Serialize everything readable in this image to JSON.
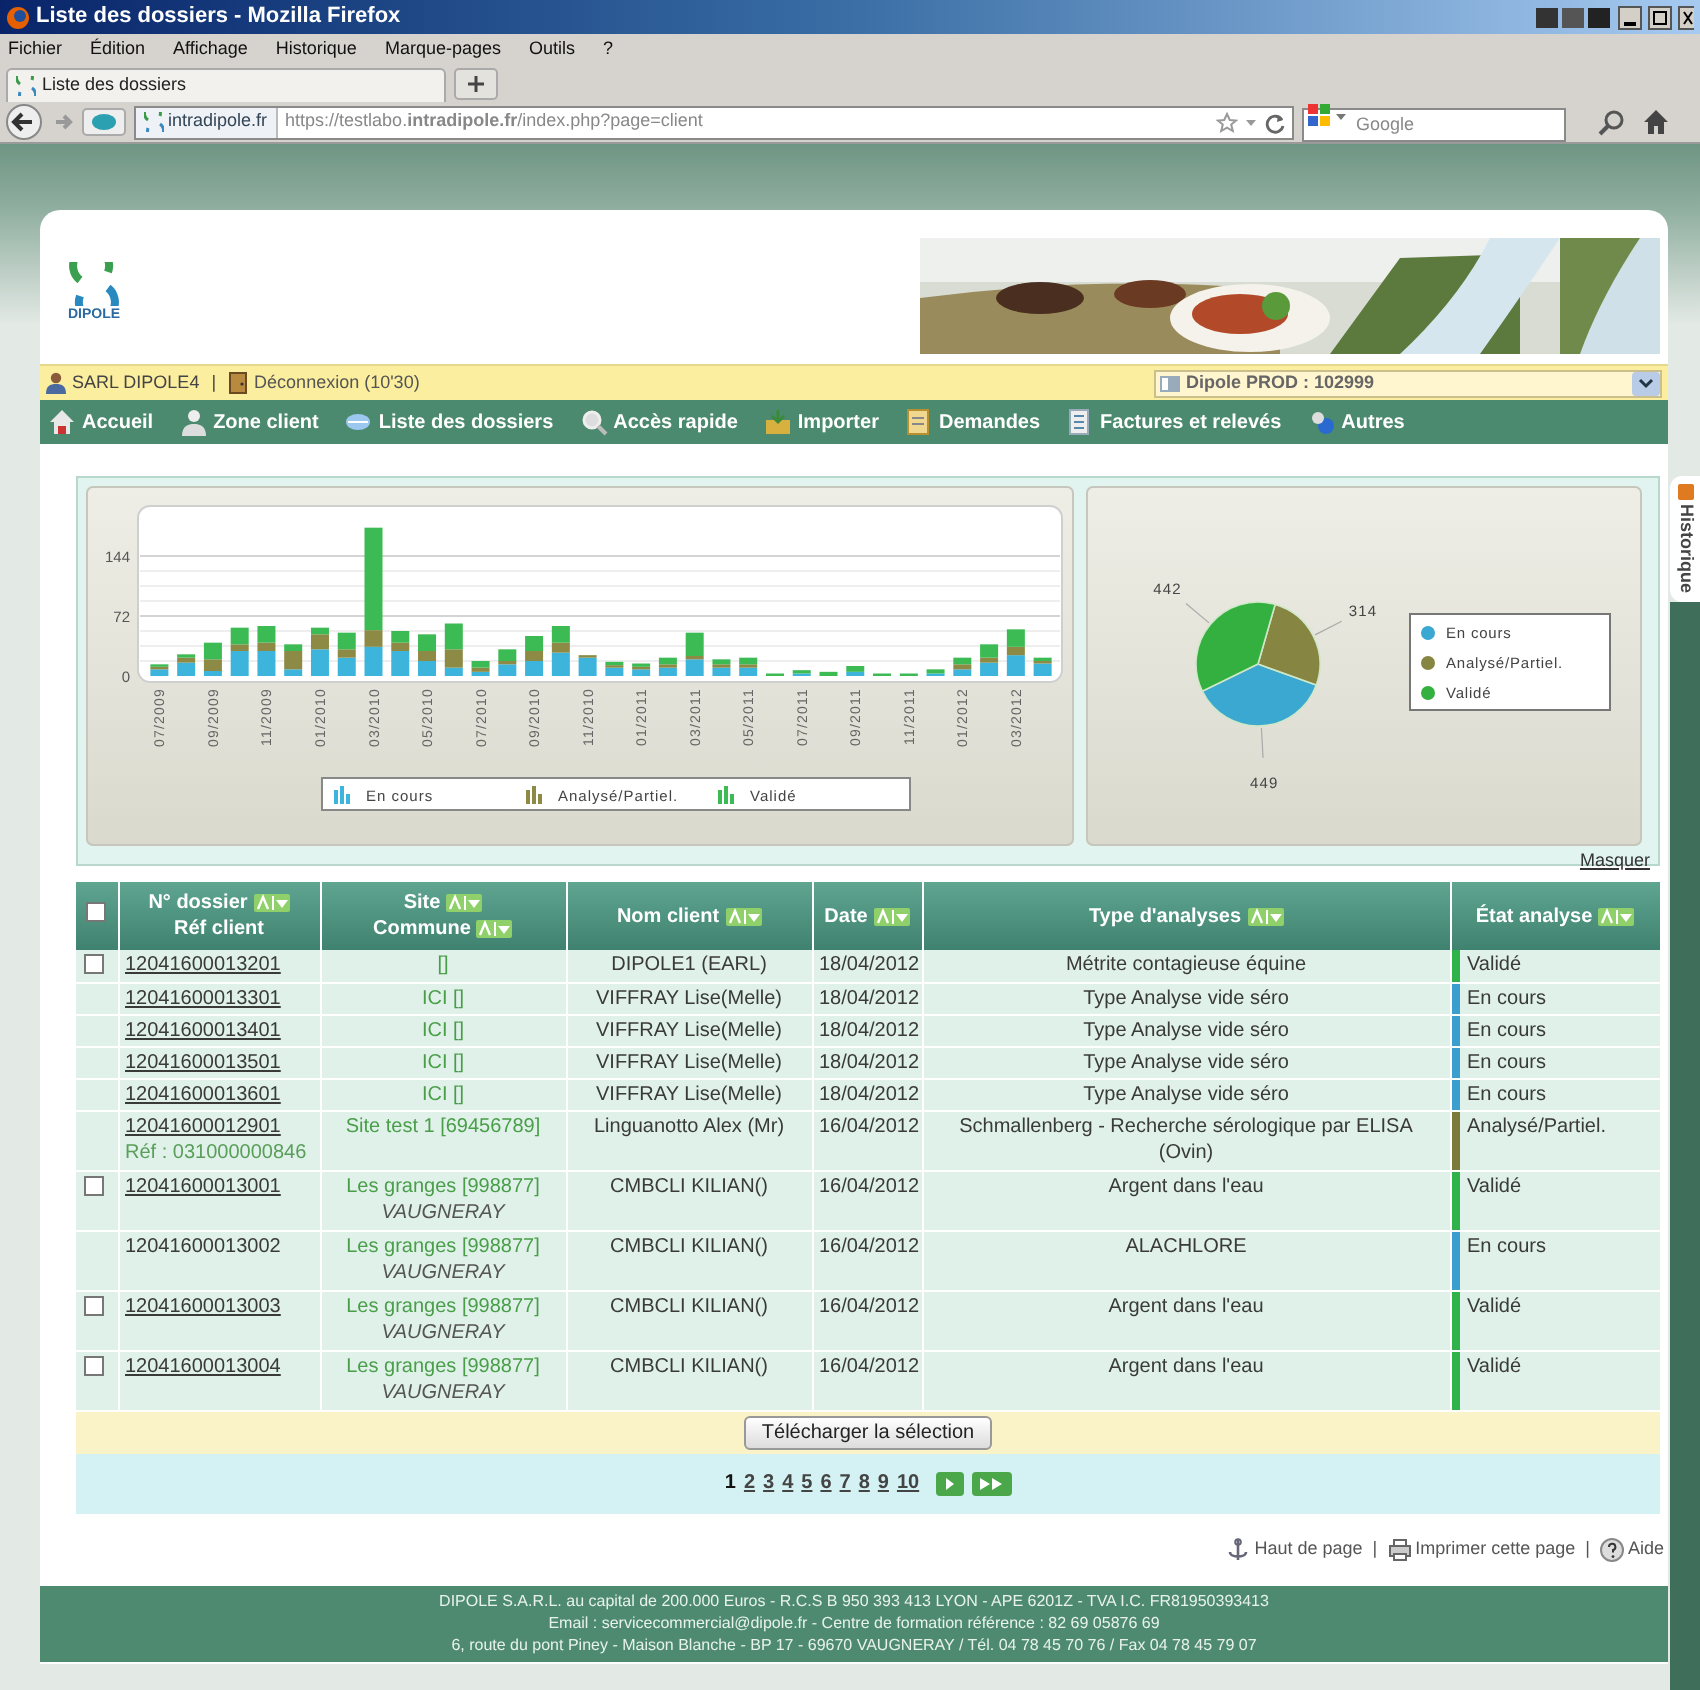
{
  "browser": {
    "title": "Liste des dossiers - Mozilla Firefox",
    "menu": [
      "Fichier",
      "Édition",
      "Affichage",
      "Historique",
      "Marque-pages",
      "Outils",
      "?"
    ],
    "tab": "Liste des dossiers",
    "identity": "intradipole.fr",
    "url": "https://testlabo.**intradipole.fr**/index.php?page=client",
    "search_placeholder": "Google"
  },
  "header": {
    "logo": "DIPOLE"
  },
  "user_bar": {
    "user": "SARL DIPOLE4",
    "separator": "|",
    "logout": "Déconnexion (10'30)",
    "account": "Dipole PROD : 102999"
  },
  "nav": [
    "Accueil",
    "Zone client",
    "Liste des dossiers",
    "Accès rapide",
    "Importer",
    "Demandes",
    "Factures et relevés",
    "Autres"
  ],
  "side_tab": "Historique",
  "bar_chart": {
    "chart_data": {
      "type": "bar",
      "stacked": true,
      "legend": "bottom",
      "categories": [
        "07/2009",
        null,
        "09/2009",
        null,
        "11/2009",
        null,
        "01/2010",
        null,
        "03/2010",
        null,
        "05/2010",
        null,
        "07/2010",
        null,
        "09/2010",
        null,
        "11/2010",
        null,
        "01/2011",
        null,
        "03/2011",
        null,
        "05/2011",
        null,
        "07/2011",
        null,
        "09/2011",
        null,
        "11/2011",
        null,
        "01/2012",
        null,
        "03/2012",
        null
      ],
      "ylim": [
        0,
        204
      ],
      "yticks": [
        0,
        72,
        144
      ],
      "series": [
        {
          "name": "En cours",
          "color": "#3db4dc",
          "values": [
            8,
            16,
            6,
            30,
            30,
            8,
            32,
            22,
            35,
            30,
            18,
            10,
            5,
            14,
            18,
            28,
            22,
            10,
            8,
            10,
            20,
            10,
            10,
            0,
            3,
            0,
            5,
            0,
            0,
            3,
            8,
            16,
            25,
            15
          ]
        },
        {
          "name": "Analysé/Partiel.",
          "color": "#8c8a44",
          "values": [
            3,
            6,
            14,
            8,
            10,
            22,
            18,
            10,
            20,
            10,
            12,
            22,
            5,
            4,
            12,
            12,
            3,
            3,
            3,
            4,
            4,
            4,
            4,
            0,
            0,
            0,
            0,
            0,
            0,
            0,
            6,
            6,
            10,
            3
          ]
        },
        {
          "name": "Validé",
          "color": "#3cba54",
          "values": [
            3,
            4,
            20,
            20,
            20,
            8,
            8,
            20,
            123,
            14,
            20,
            31,
            8,
            14,
            18,
            20,
            0,
            4,
            4,
            8,
            28,
            6,
            8,
            3,
            4,
            5,
            7,
            3,
            3,
            5,
            8,
            16,
            21,
            4
          ]
        }
      ]
    }
  },
  "pie_chart": {
    "chart_data": {
      "type": "pie",
      "data_labels": true,
      "legend": "right",
      "categories": [
        "En cours",
        "Analysé/Partiel.",
        "Validé"
      ],
      "values": [
        449,
        314,
        442
      ]
    }
  },
  "hide_link": "Masquer",
  "table": {
    "header_checkbox": {
      "checked": false
    },
    "columns": [
      {
        "lines": [
          {
            "text": "N° dossier",
            "sort": true
          },
          {
            "text": "Réf client",
            "sort": false
          }
        ]
      },
      {
        "lines": [
          {
            "text": "Site",
            "sort": true
          },
          {
            "text": "Commune",
            "sort": true
          }
        ]
      },
      {
        "lines": [
          {
            "text": "Nom client",
            "sort": true
          }
        ]
      },
      {
        "lines": [
          {
            "text": "Date",
            "sort": true
          }
        ]
      },
      {
        "lines": [
          {
            "text": "Type d'analyses",
            "sort": true
          }
        ]
      },
      {
        "lines": [
          {
            "text": "État analyse",
            "sort": true
          }
        ]
      }
    ],
    "rows": [
      {
        "checkbox": {
          "checked": false
        },
        "dossier": "12041600013201",
        "linked": true,
        "site": "[]",
        "client": "DIPOLE1 (EARL)",
        "date": "18/04/2012",
        "analyse": "Métrite contagieuse équine",
        "etat": "Validé",
        "color": "#2fb24a"
      },
      {
        "dossier": "12041600013301",
        "linked": true,
        "site": "ICI []",
        "client": "VIFFRAY Lise(Melle)",
        "date": "18/04/2012",
        "analyse": "Type Analyse vide séro",
        "etat": "En cours",
        "color": "#3a9fcf"
      },
      {
        "dossier": "12041600013401",
        "linked": true,
        "site": "ICI []",
        "client": "VIFFRAY Lise(Melle)",
        "date": "18/04/2012",
        "analyse": "Type Analyse vide séro",
        "etat": "En cours",
        "color": "#3a9fcf"
      },
      {
        "dossier": "12041600013501",
        "linked": true,
        "site": "ICI []",
        "client": "VIFFRAY Lise(Melle)",
        "date": "18/04/2012",
        "analyse": "Type Analyse vide séro",
        "etat": "En cours",
        "color": "#3a9fcf"
      },
      {
        "dossier": "12041600013601",
        "linked": true,
        "site": "ICI []",
        "client": "VIFFRAY Lise(Melle)",
        "date": "18/04/2012",
        "analyse": "Type Analyse vide séro",
        "etat": "En cours",
        "color": "#3a9fcf"
      },
      {
        "dossier": "12041600012901",
        "linked": true,
        "ref": "Réf : 031000000846",
        "site": "Site test 1 [69456789]",
        "client": "Linguanotto Alex (Mr)",
        "date": "16/04/2012",
        "analyse": "Schmallenberg - Recherche sérologique par ELISA (Ovin)",
        "etat": "Analysé/Partiel.",
        "color": "#7c7a3a"
      },
      {
        "checkbox": {
          "checked": false
        },
        "dossier": "12041600013001",
        "linked": true,
        "site": "Les granges [998877]",
        "commune": "VAUGNERAY",
        "client": "CMBCLI KILIAN()",
        "date": "16/04/2012",
        "analyse": "Argent dans l'eau",
        "etat": "Validé",
        "color": "#2fb24a"
      },
      {
        "dossier": "12041600013002",
        "linked": false,
        "site": "Les granges [998877]",
        "commune": "VAUGNERAY",
        "client": "CMBCLI KILIAN()",
        "date": "16/04/2012",
        "analyse": "ALACHLORE",
        "etat": "En cours",
        "color": "#3a9fcf"
      },
      {
        "checkbox": {
          "checked": false
        },
        "dossier": "12041600013003",
        "linked": true,
        "site": "Les granges [998877]",
        "commune": "VAUGNERAY",
        "client": "CMBCLI KILIAN()",
        "date": "16/04/2012",
        "analyse": "Argent dans l'eau",
        "etat": "Validé",
        "color": "#2fb24a"
      },
      {
        "checkbox": {
          "checked": false
        },
        "dossier": "12041600013004",
        "linked": true,
        "site": "Les granges [998877]",
        "commune": "VAUGNERAY",
        "client": "CMBCLI KILIAN()",
        "date": "16/04/2012",
        "analyse": "Argent dans l'eau",
        "etat": "Validé",
        "color": "#2fb24a"
      }
    ]
  },
  "download_button": "Télécharger la sélection",
  "pagination": {
    "pages": [
      {
        "label": "1",
        "selected": true
      },
      {
        "label": "2",
        "selected": false
      },
      {
        "label": "3",
        "selected": false
      },
      {
        "label": "4",
        "selected": false
      },
      {
        "label": "5",
        "selected": false
      },
      {
        "label": "6",
        "selected": false
      },
      {
        "label": "7",
        "selected": false
      },
      {
        "label": "8",
        "selected": false
      },
      {
        "label": "9",
        "selected": false
      },
      {
        "label": "10",
        "selected": false
      }
    ]
  },
  "page_links": {
    "separator": "|",
    "items": [
      "Haut de page",
      "Imprimer cette page",
      "Aide"
    ]
  },
  "footer": [
    "DIPOLE S.A.R.L. au capital de 200.000 Euros - R.C.S B 950 393 413 LYON - APE 6201Z - TVA I.C. FR81950393413",
    "Email : servicecommercial@dipole.fr - Centre de formation référence : 82 69 05876 69",
    "6, route du pont Piney - Maison Blanche - BP 17 - 69670 VAUGNERAY / Tél. 04 78 45 70 76 / Fax 04 78 45 79 07"
  ]
}
